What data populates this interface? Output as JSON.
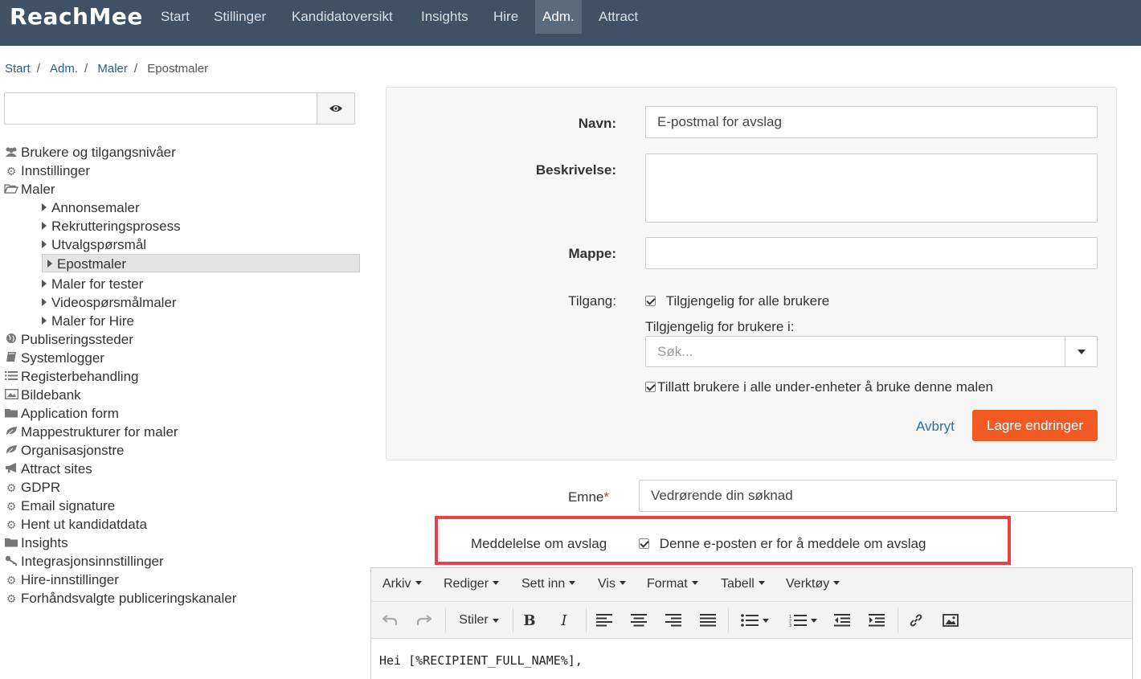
{
  "app": {
    "logo": "ReachMee",
    "nav": [
      "Start",
      "Stillinger",
      "Kandidatoversikt",
      "Insights",
      "Hire",
      "Adm.",
      "Attract"
    ],
    "active_nav": "Adm."
  },
  "breadcrumb": [
    "Start",
    "Adm.",
    "Maler",
    "Epostmaler"
  ],
  "sidebar": {
    "search_value": "",
    "items": [
      {
        "label": "Brukere og tilgangsnivåer",
        "icon": "users-icon"
      },
      {
        "label": "Innstillinger",
        "icon": "gear-icon"
      },
      {
        "label": "Maler",
        "icon": "folder-open-icon"
      },
      {
        "label": "Annonsemaler",
        "icon": "caret-right-icon"
      },
      {
        "label": "Rekrutteringsprosess",
        "icon": "caret-right-icon"
      },
      {
        "label": "Utvalgspørsmål",
        "icon": "caret-right-icon"
      },
      {
        "label": "Epostmaler",
        "icon": "caret-right-icon"
      },
      {
        "label": "Maler for tester",
        "icon": "caret-right-icon"
      },
      {
        "label": "Videospørsmålmaler",
        "icon": "caret-right-icon"
      },
      {
        "label": "Maler for Hire",
        "icon": "caret-right-icon"
      },
      {
        "label": "Publiseringssteder",
        "icon": "globe-icon"
      },
      {
        "label": "Systemlogger",
        "icon": "book-icon"
      },
      {
        "label": "Registerbehandling",
        "icon": "list-icon"
      },
      {
        "label": "Bildebank",
        "icon": "image-icon"
      },
      {
        "label": "Application form",
        "icon": "folder-icon"
      },
      {
        "label": "Mappestrukturer for maler",
        "icon": "leaf-icon"
      },
      {
        "label": "Organisasjonstre",
        "icon": "leaf-icon"
      },
      {
        "label": "Attract sites",
        "icon": "bullhorn-icon"
      },
      {
        "label": "GDPR",
        "icon": "gear-icon"
      },
      {
        "label": "Email signature",
        "icon": "gear-icon"
      },
      {
        "label": "Hent ut kandidatdata",
        "icon": "gear-icon"
      },
      {
        "label": "Insights",
        "icon": "folder-icon"
      },
      {
        "label": "Integrasjonsinnstillinger",
        "icon": "key-icon"
      },
      {
        "label": "Hire-innstillinger",
        "icon": "gear-icon"
      },
      {
        "label": "Forhåndsvalgte publiceringskanaler",
        "icon": "gear-icon"
      }
    ],
    "selected": "Epostmaler"
  },
  "form": {
    "name_label": "Navn:",
    "name_value": "E-postmal for avslag",
    "desc_label": "Beskrivelse:",
    "desc_value": "",
    "folder_label": "Mappe:",
    "folder_value": "",
    "access_label": "Tilgang:",
    "access_all_label": "Tilgjengelig for alle brukere",
    "access_all_checked": true,
    "available_for_label": "Tilgjengelig for brukere i:",
    "search_placeholder": "Søk...",
    "allow_subunits_label": "Tillatt brukere i alle under-enheter å bruke denne malen",
    "allow_subunits_checked": true,
    "cancel_label": "Avbryt",
    "save_label": "Lagre endringer"
  },
  "subject": {
    "label": "Emne",
    "required_mark": "*",
    "value": "Vedrørende din søknad"
  },
  "rejection": {
    "label": "Meddelelse om avslag",
    "checkbox_label": "Denne e-posten er for å meddele om avslag",
    "checked": true
  },
  "editor": {
    "menus": [
      "Arkiv",
      "Rediger",
      "Sett inn",
      "Vis",
      "Format",
      "Tabell",
      "Verktøy"
    ],
    "styles_label": "Stiler",
    "body_text": "Hei [%RECIPIENT_FULL_NAME%],"
  },
  "colors": {
    "nav_bg": "#3e5165",
    "accent": "#f15a22",
    "link": "#2a6ea6",
    "highlight": "#e8414a"
  }
}
